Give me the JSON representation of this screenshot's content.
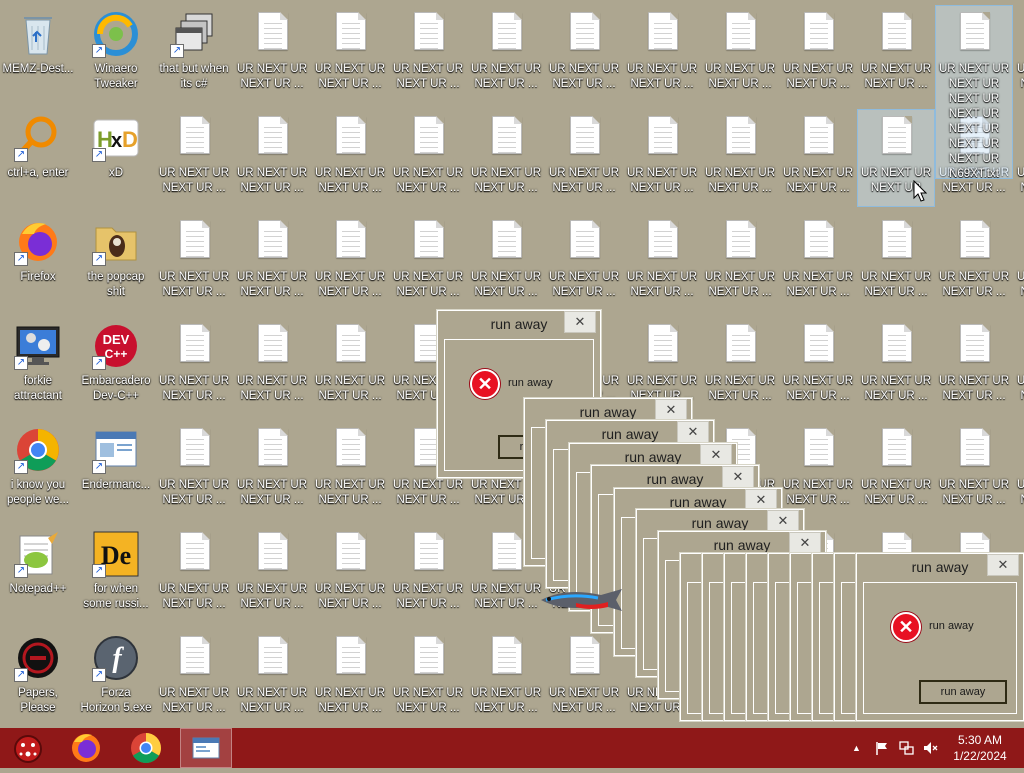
{
  "desktop": {
    "icons": [
      {
        "id": "recycle",
        "label": "MEMZ-Dest...",
        "art": "recycle-bin-icon",
        "col": 0,
        "row": 0,
        "shortcut": false
      },
      {
        "id": "winaero",
        "label": "Winaero Tweaker",
        "art": "winaero-tweaker-icon",
        "col": 1,
        "row": 0,
        "shortcut": true
      },
      {
        "id": "thatbut",
        "label": "that but when its c#",
        "art": "windows-stack-icon",
        "col": 2,
        "row": 0,
        "shortcut": true
      },
      {
        "id": "ctrla",
        "label": "ctrl+a, enter",
        "art": "magnifier-icon",
        "col": 0,
        "row": 1,
        "shortcut": true
      },
      {
        "id": "hxd",
        "label": "xD",
        "art": "hxd-icon",
        "col": 1,
        "row": 1,
        "shortcut": true
      },
      {
        "id": "firefox",
        "label": "Firefox",
        "art": "firefox-icon",
        "col": 0,
        "row": 2,
        "shortcut": true
      },
      {
        "id": "popcap",
        "label": "the popcap shit",
        "art": "folder-icon",
        "col": 1,
        "row": 2,
        "shortcut": true
      },
      {
        "id": "forkie",
        "label": "forkie attractant",
        "art": "monitor-gear-icon",
        "col": 0,
        "row": 3,
        "shortcut": true
      },
      {
        "id": "devcpp",
        "label": "Embarcadero Dev-C++",
        "art": "devcpp-icon",
        "col": 1,
        "row": 3,
        "shortcut": true
      },
      {
        "id": "chrome",
        "label": "i know you people we...",
        "art": "chrome-icon",
        "col": 0,
        "row": 4,
        "shortcut": true
      },
      {
        "id": "endermanch",
        "label": "Endermanc...",
        "art": "window-app-icon",
        "col": 1,
        "row": 4,
        "shortcut": true
      },
      {
        "id": "notepadpp",
        "label": "Notepad++",
        "art": "notepadpp-icon",
        "col": 0,
        "row": 5,
        "shortcut": true
      },
      {
        "id": "forwhen",
        "label": "for when some russi...",
        "art": "de-icon",
        "col": 1,
        "row": 5,
        "shortcut": true
      },
      {
        "id": "papers",
        "label": "Papers, Please",
        "art": "papers-please-icon",
        "col": 0,
        "row": 6,
        "shortcut": true
      },
      {
        "id": "forza",
        "label": "Forza Horizon 5.exe",
        "art": "flash-icon",
        "col": 1,
        "row": 6,
        "shortcut": true
      }
    ],
    "doc_label": "UR NEXT UR NEXT UR ...",
    "doc_label_full": "UR NEXT UR NEXT UR NEXT UR NEXT UR NEXT UR NEXT UR NEXT UR N69XT.txt",
    "doc_label_hover": "UR NEXT UR NEXT UR"
  },
  "dialogs": {
    "title": "run away",
    "message": "run away",
    "button": "run away",
    "close": "✕"
  },
  "taskbar": {
    "clock_time": "5:30 AM",
    "clock_date": "1/22/2024",
    "apps": [
      "memz-icon",
      "firefox-icon",
      "chrome-icon",
      "window-app-icon"
    ]
  },
  "colors": {
    "desktop": "#ada690",
    "taskbar": "#8f1818",
    "error": "#e81123"
  }
}
